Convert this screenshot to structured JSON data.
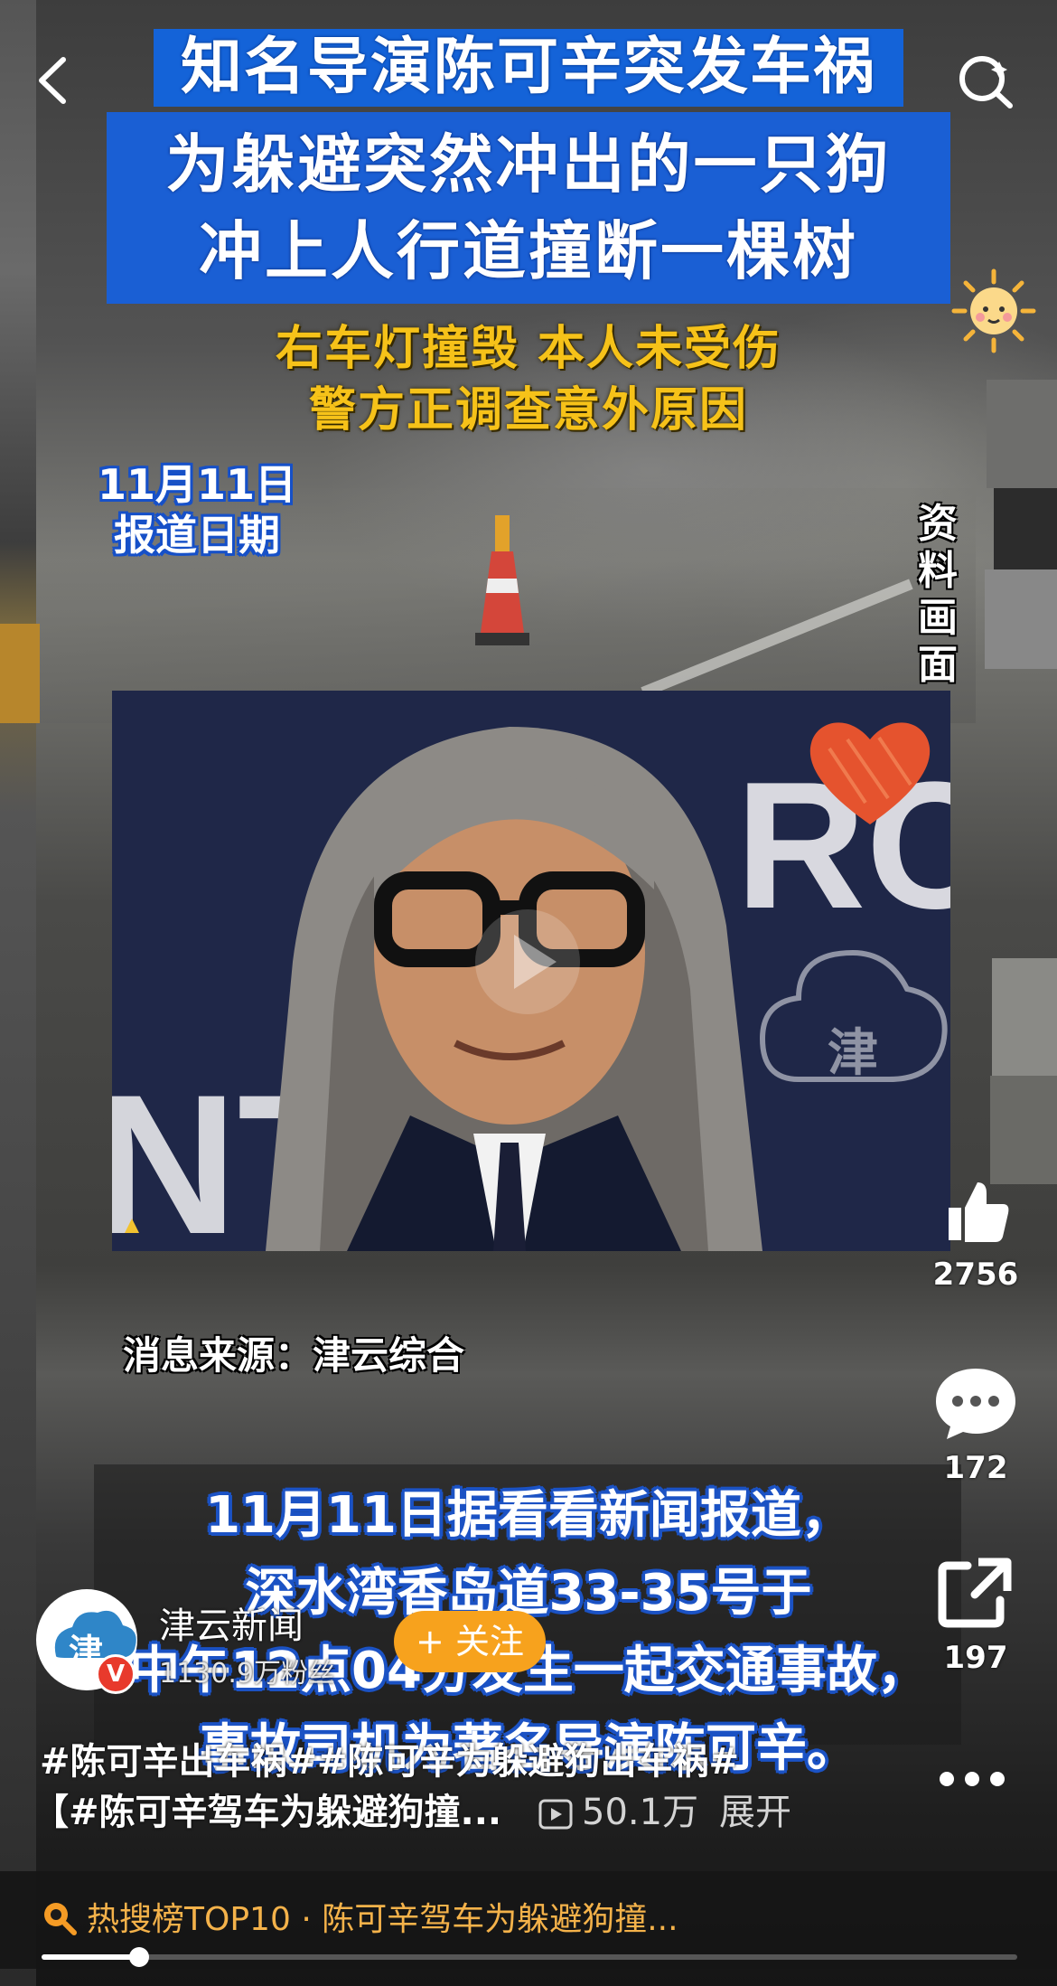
{
  "headline": "知名导演陈可辛突发车祸",
  "subhead": [
    "为躲避突然冲出的一只狗",
    "冲上人行道撞断一棵树"
  ],
  "yellow_lines": [
    "右车灯撞毁 本人未受伤",
    "警方正调查意外原因"
  ],
  "date_tag": [
    "11月11日",
    "报道日期"
  ],
  "archive_label": [
    "资",
    "料",
    "画",
    "面"
  ],
  "source": "消息来源：津云综合",
  "caption": [
    "11月11日据看看新闻报道，",
    "深水湾香岛道33-35号于",
    "中午12点04分发生一起交通事故，",
    "事故司机为著名导演陈可辛。"
  ],
  "author": {
    "name": "津云新闻",
    "fans": "1130.9万粉丝",
    "avatar_char": "津",
    "verified_mark": "V"
  },
  "follow_label": "+ 关注",
  "rail": {
    "likes": "2756",
    "comments": "172",
    "shares": "197"
  },
  "tags_line": "#陈可辛出车祸##陈可辛为躲避狗出车祸#",
  "desc_line": "【#陈可辛驾车为躲避狗撞...",
  "views": "50.1万",
  "expand_label": "展开",
  "hot": {
    "rank": "热搜榜TOP10",
    "sep": "·",
    "title": "陈可辛驾车为躲避狗撞..."
  },
  "playback_progress": 0.1,
  "colors": {
    "headline_bg": "#1463d8",
    "yellow_text": "#f6c219",
    "follow_btn": "#f7a21d",
    "verified_badge": "#e83a2c",
    "hot_text": "#f4b24a"
  },
  "icons": [
    "back-arrow-icon",
    "search-icon",
    "sun-sticker-icon",
    "heart-sticker-icon",
    "like-icon",
    "comment-icon",
    "share-icon",
    "more-icon",
    "play-count-icon",
    "hot-search-icon"
  ]
}
